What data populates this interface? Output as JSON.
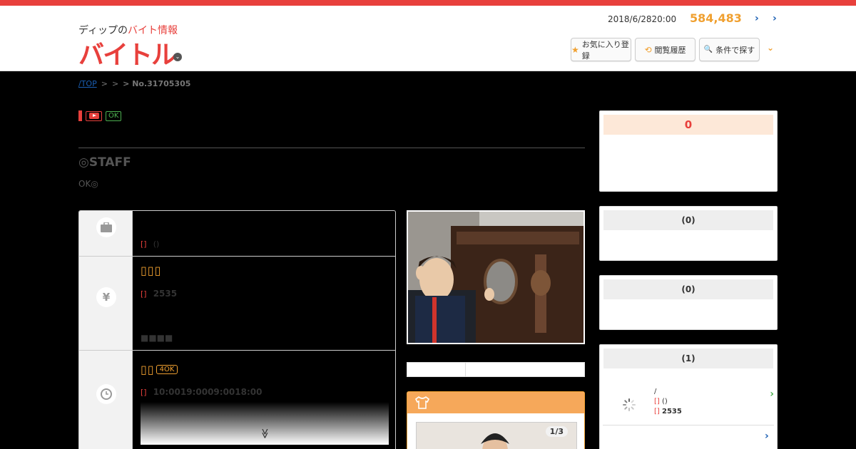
{
  "header": {
    "logo_sub_black": "ディップの",
    "logo_sub_red": "バイト情報",
    "logo_main": "バイトル",
    "date": "2018/6/2820:00",
    "count": "584,483",
    "arrow1": "›",
    "arrow2": "›",
    "buttons": [
      {
        "icon": "★",
        "label": "お気に入り登録"
      },
      {
        "icon": "⟲",
        "label": "閲覧履歴"
      },
      {
        "icon": "🔍",
        "label": "条件で探す"
      }
    ],
    "chevron": "⌄"
  },
  "breadcrumb": {
    "top": "/TOP",
    "sep1": ">",
    "sep2": ">",
    "last": "> No.31705305"
  },
  "badges": {
    "ok": "OK"
  },
  "job": {
    "title": "◎STAFF",
    "subtitle": "OK◎"
  },
  "info": {
    "row1": {
      "tag": "[]",
      "text": "()"
    },
    "row2": {
      "title": "▯▯▯",
      "tag": "[]",
      "wage": "2535",
      "extra": "■■■■"
    },
    "row3": {
      "title": "▯▯",
      "pill": "4OK",
      "tag": "[]",
      "hours": "10:0019:0009:0018:00",
      "more": "≫"
    }
  },
  "gallery": {
    "count": "1/3"
  },
  "sidebar": {
    "box1_value": "0",
    "box2_title": "(0)",
    "box3_title": "(0)",
    "box4_title": "(1)",
    "list": {
      "line1": "/",
      "tag1": "[]",
      "text1": "()",
      "tag2": "[]",
      "wage": "2535",
      "arrow": "›"
    },
    "bottom_arrow": "›"
  }
}
